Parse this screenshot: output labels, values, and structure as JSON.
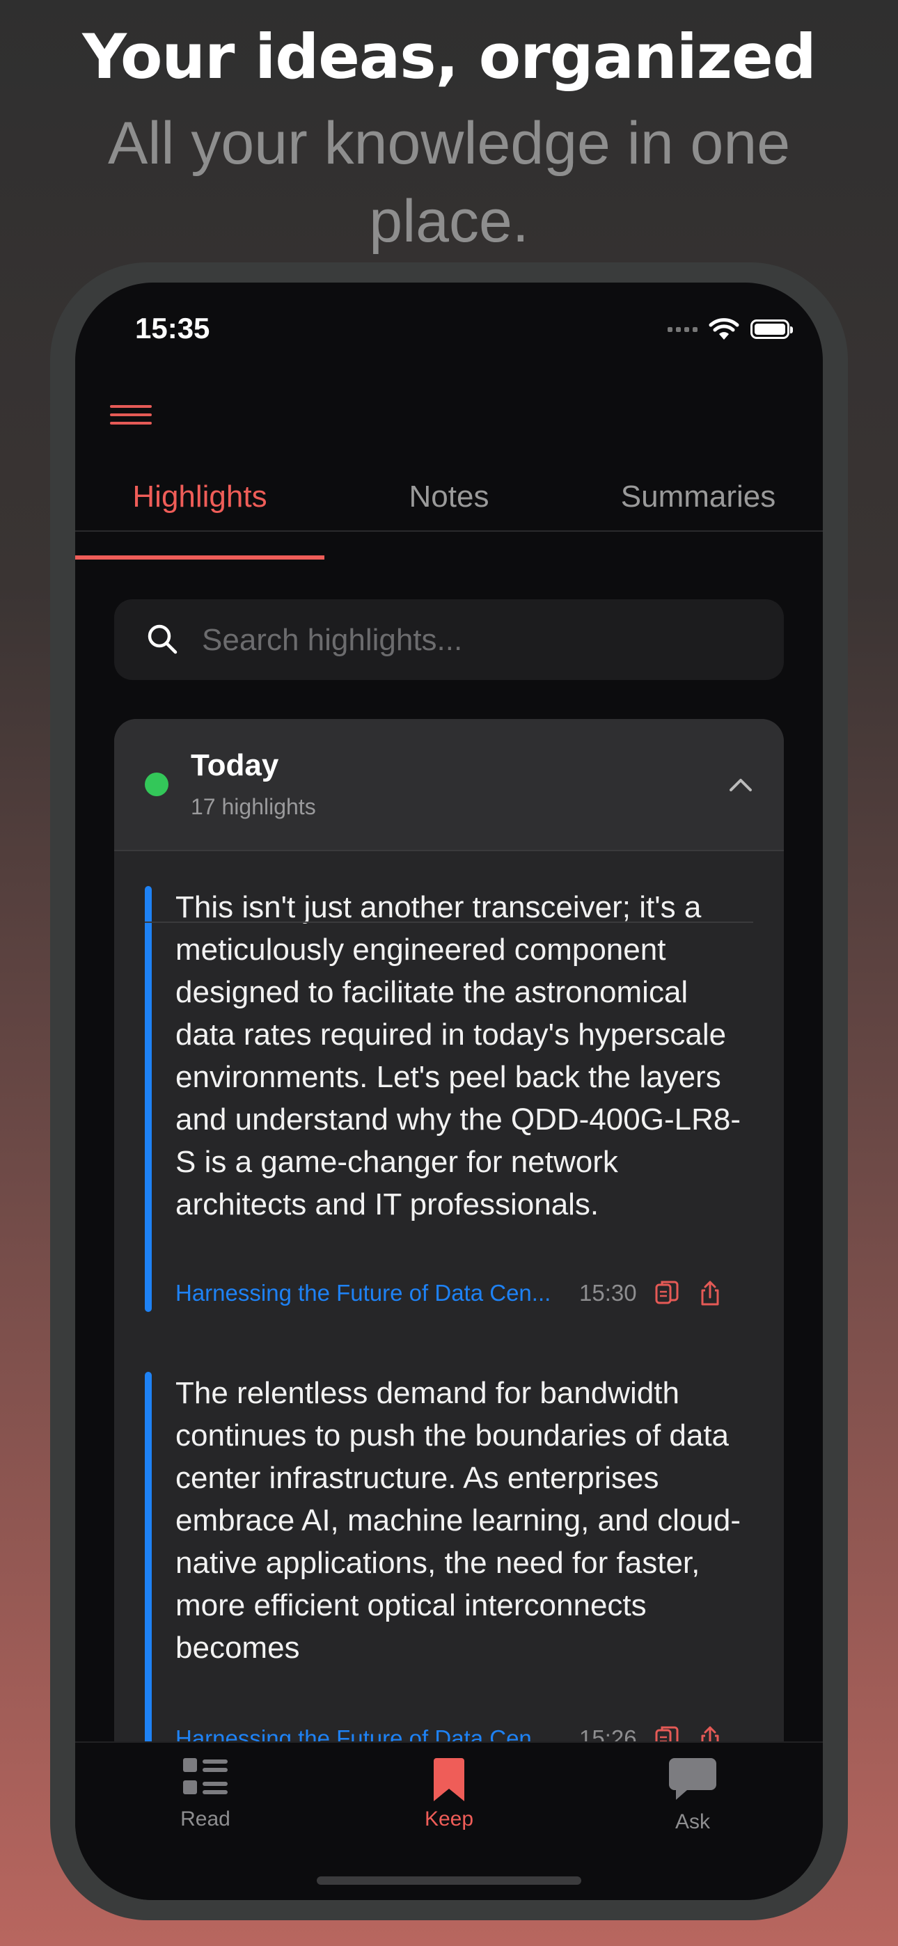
{
  "headline": "Your ideas, organized",
  "subheadline": "All your knowledge in one place.",
  "status_bar": {
    "time": "15:35"
  },
  "tabs": [
    {
      "label": "Highlights",
      "active": true
    },
    {
      "label": "Notes",
      "active": false
    },
    {
      "label": "Summaries",
      "active": false
    }
  ],
  "search": {
    "placeholder": "Search highlights..."
  },
  "group": {
    "title": "Today",
    "count": "17 highlights",
    "expanded": true
  },
  "highlights": [
    {
      "text": "This isn't just another transceiver; it's a meticulously engineered component designed to facilitate the astronomical data rates required in today's hyperscale environments. Let's peel back the layers and understand why the QDD-400G-LR8-S is a game-changer for network architects and IT professionals.",
      "source": "Harnessing the Future of Data Cen...",
      "time": "15:30"
    },
    {
      "text": "The relentless demand for bandwidth continues to push the boundaries of data center infrastructure. As enterprises embrace AI, machine learning, and cloud-native applications, the need for faster, more efficient optical interconnects becomes",
      "source": "Harnessing the Future of Data Cen...",
      "time": "15:26"
    }
  ],
  "bottom_nav": [
    {
      "label": "Read",
      "icon": "list-icon",
      "active": false
    },
    {
      "label": "Keep",
      "icon": "bookmark-icon",
      "active": true
    },
    {
      "label": "Ask",
      "icon": "chat-bubble-icon",
      "active": false
    }
  ],
  "colors": {
    "accent": "#ef5d58",
    "link": "#1e82f5",
    "status_green": "#33c759",
    "screen_bg": "#0c0c0e",
    "card_bg": "#262628"
  }
}
